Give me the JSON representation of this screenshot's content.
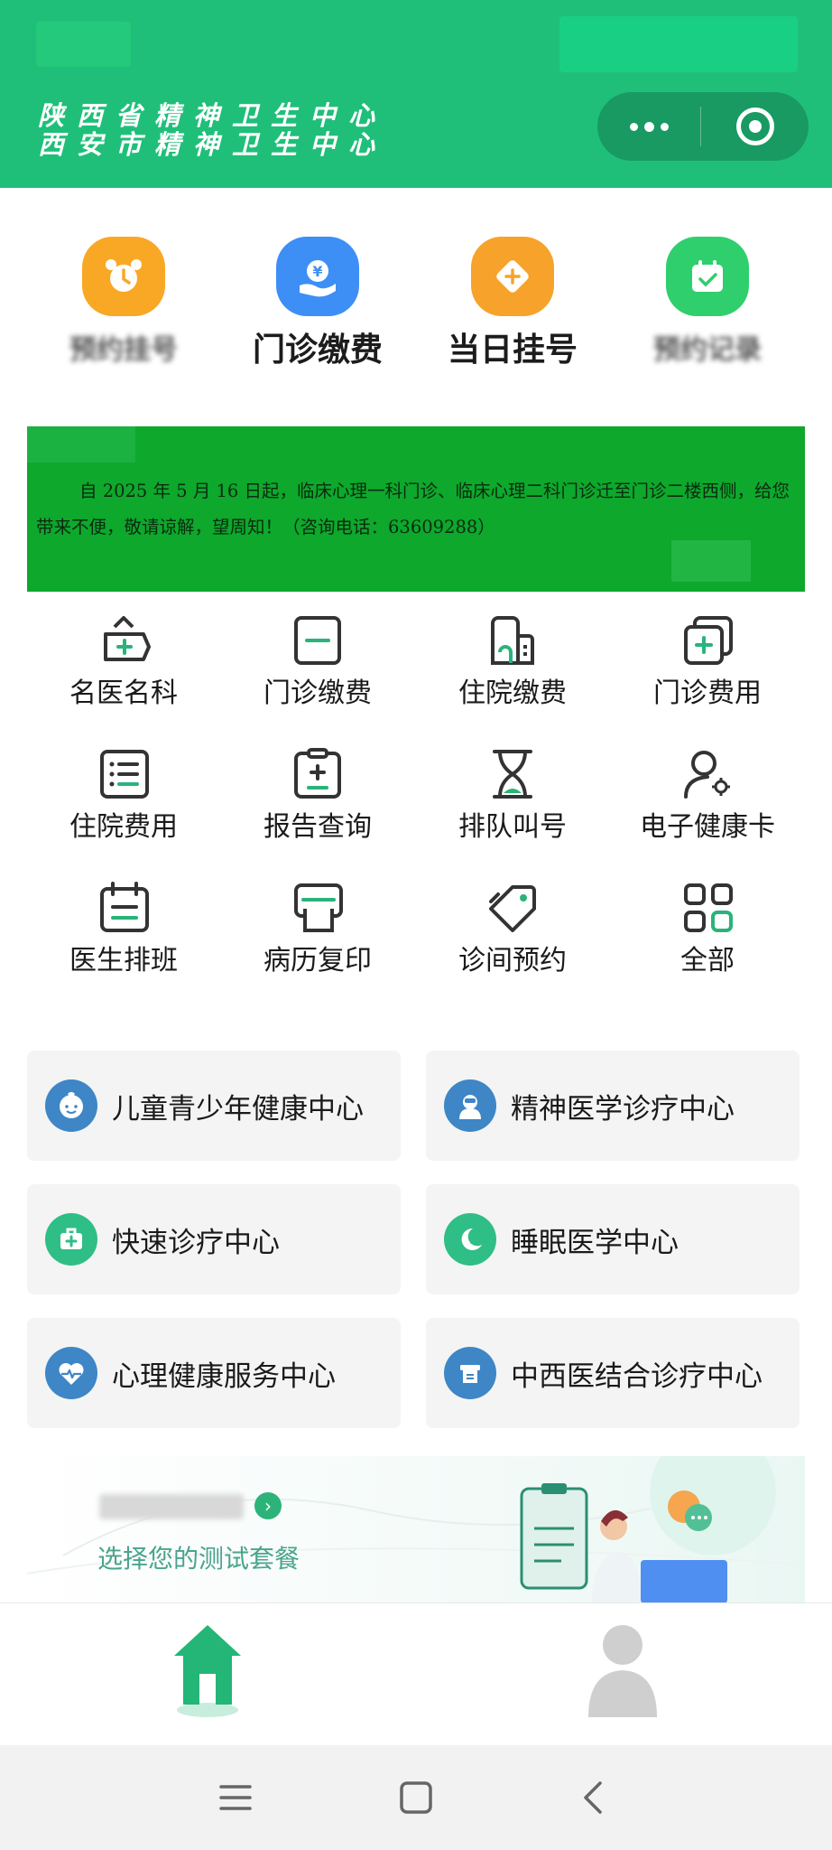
{
  "header": {
    "title_line1": "陕西省精神卫生中心",
    "title_line2": "西安市精神卫生中心",
    "brand_color": "#1fbf7a"
  },
  "quick_actions": [
    {
      "label": "预约挂号",
      "icon": "alarm-clock-icon",
      "color": "#f9a825",
      "blurred": true
    },
    {
      "label": "门诊缴费",
      "icon": "payment-hand-icon",
      "color": "#3d8ff5",
      "blurred": false
    },
    {
      "label": "当日挂号",
      "icon": "ticket-icon",
      "color": "#f7a22a",
      "blurred": false
    },
    {
      "label": "预约记录",
      "icon": "calendar-check-icon",
      "color": "#2fcf6d",
      "blurred": true
    }
  ],
  "banner": {
    "text": "自 2025 年 5 月 16 日起，临床心理一科门诊、临床心理二科门诊迁至门诊二楼西侧，给您带来不便，敬请谅解，望周知！（咨询电话：63609288）"
  },
  "grid": [
    {
      "label": "名医名科",
      "icon": "doctor-bag-icon"
    },
    {
      "label": "门诊缴费",
      "icon": "card-minus-icon"
    },
    {
      "label": "住院缴费",
      "icon": "hospital-building-icon"
    },
    {
      "label": "门诊费用",
      "icon": "copy-plus-icon"
    },
    {
      "label": "住院费用",
      "icon": "list-icon"
    },
    {
      "label": "报告查询",
      "icon": "clipboard-plus-icon"
    },
    {
      "label": "排队叫号",
      "icon": "hourglass-icon"
    },
    {
      "label": "电子健康卡",
      "icon": "user-gear-icon"
    },
    {
      "label": "医生排班",
      "icon": "calendar-list-icon"
    },
    {
      "label": "病历复印",
      "icon": "printer-icon"
    },
    {
      "label": "诊间预约",
      "icon": "tag-icon"
    },
    {
      "label": "全部",
      "icon": "apps-grid-icon"
    }
  ],
  "centers": [
    {
      "label": "儿童青少年健康中心",
      "icon": "child-face-icon",
      "color": "#3e86c6"
    },
    {
      "label": "精神医学诊疗中心",
      "icon": "doctor-avatar-icon",
      "color": "#3e86c6"
    },
    {
      "label": "快速诊疗中心",
      "icon": "first-aid-kit-icon",
      "color": "#2fbe86"
    },
    {
      "label": "睡眠医学中心",
      "icon": "moon-icon",
      "color": "#2fbe86"
    },
    {
      "label": "心理健康服务中心",
      "icon": "heart-pulse-icon",
      "color": "#3e86c6"
    },
    {
      "label": "中西医结合诊疗中心",
      "icon": "herbal-box-icon",
      "color": "#3e86c6"
    }
  ],
  "promo": {
    "subtitle": "选择您的测试套餐"
  },
  "tabbar": {
    "home_icon": "home-icon",
    "profile_icon": "profile-icon",
    "active_color": "#23b676"
  },
  "system_nav": {
    "menu_icon": "menu-icon",
    "home_icon": "square-icon",
    "back_icon": "back-chevron-icon"
  }
}
